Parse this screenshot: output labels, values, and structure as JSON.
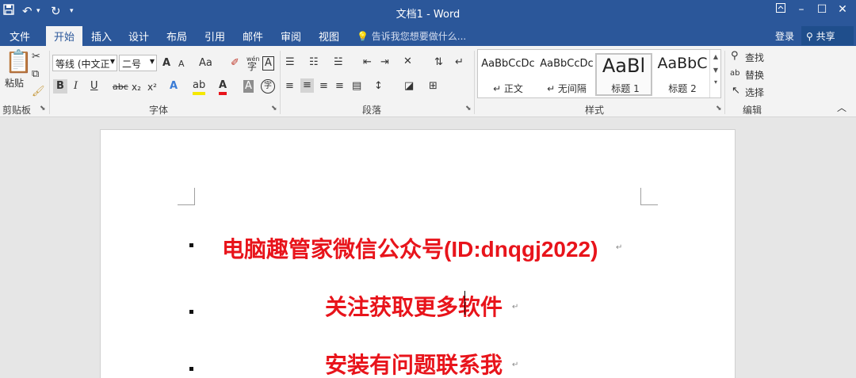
{
  "window": {
    "title": "文档1 - Word"
  },
  "tabs": [
    "文件",
    "开始",
    "插入",
    "设计",
    "布局",
    "引用",
    "邮件",
    "审阅",
    "视图"
  ],
  "tell_me": "告诉我您想要做什么...",
  "account": {
    "login": "登录",
    "share": "共享"
  },
  "ribbon": {
    "clipboard": {
      "paste": "粘贴",
      "label": "剪贴板"
    },
    "font": {
      "font_name": "等线 (中文正",
      "font_size": "二号",
      "label": "字体",
      "bold": "B",
      "italic": "I",
      "underline": "U",
      "strike": "abc",
      "subscript": "x₂",
      "superscript": "x²",
      "case": "Aa",
      "grow": "A",
      "shrink": "A",
      "phonetic_top": "wén",
      "phonetic": "字",
      "border_char": "A",
      "font_color": "A",
      "shade": "A",
      "enclose": "字"
    },
    "paragraph": {
      "label": "段落"
    },
    "styles": {
      "label": "样式",
      "items": [
        {
          "sample": "AaBbCcDc",
          "name": "↵ 正文"
        },
        {
          "sample": "AaBbCcDc",
          "name": "↵ 无间隔"
        },
        {
          "sample": "AaBl",
          "name": "标题 1"
        },
        {
          "sample": "AaBbC",
          "name": "标题 2"
        }
      ]
    },
    "editing": {
      "label": "编辑",
      "find": "查找",
      "replace": "替换",
      "select": "选择"
    }
  },
  "document": {
    "lines": [
      "电脑趣管家微信公众号(ID:dnqgj2022)",
      "关注获取更多软件",
      "安装有问题联系我"
    ]
  },
  "colors": {
    "title_bar": "#2b579a",
    "ribbon_bg": "#f3f3f3",
    "doc_text": "#e8141b"
  }
}
